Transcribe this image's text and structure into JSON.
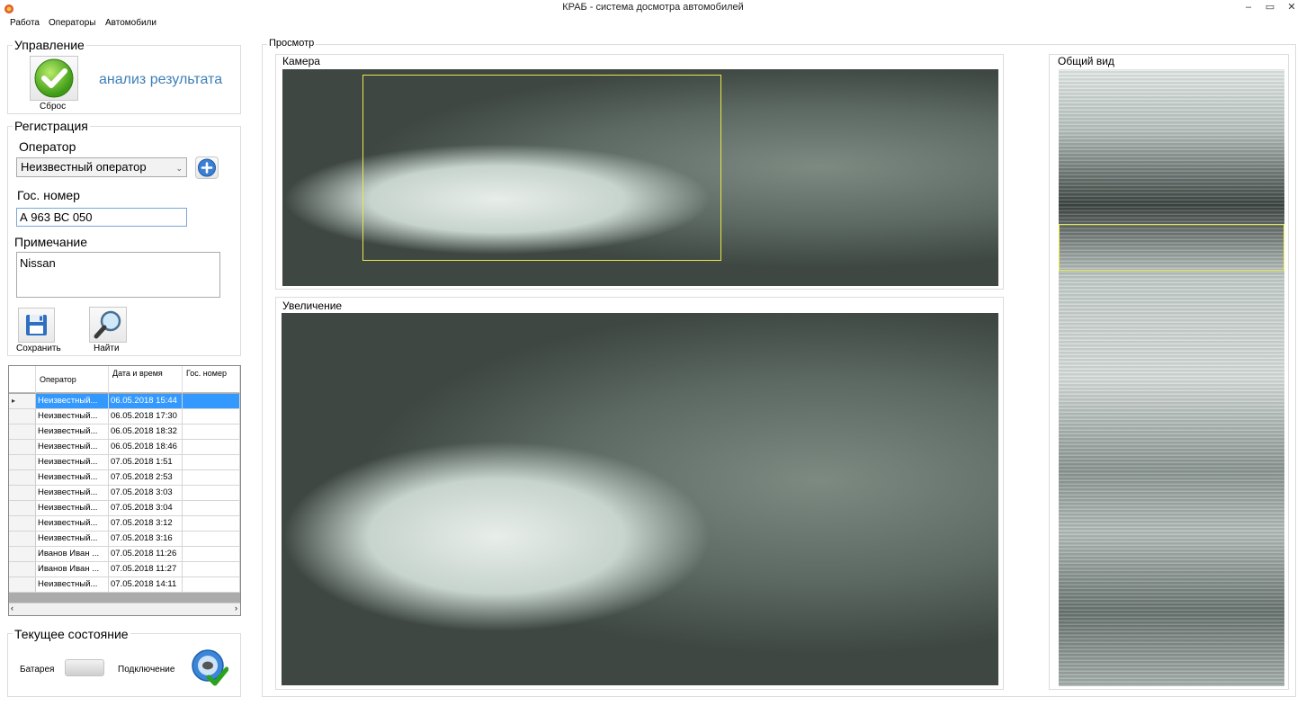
{
  "window": {
    "title": "КРАБ - система досмотра автомобилей",
    "controls": [
      "–",
      "▭",
      "✕"
    ]
  },
  "menu": [
    "Работа",
    "Операторы",
    "Автомобили"
  ],
  "control": {
    "title": "Управление",
    "reset_label": "Сброс",
    "status_text": "анализ результата"
  },
  "registration": {
    "title": "Регистрация",
    "operator_label": "Оператор",
    "operator_value": "Неизвестный оператор",
    "plate_label": "Гос. номер",
    "plate_value": "А 963 ВС 050",
    "note_label": "Примечание",
    "note_value": "Nissan",
    "save_label": "Сохранить",
    "find_label": "Найти"
  },
  "table": {
    "columns": [
      "Оператор",
      "Дата и время",
      "Гос. номер"
    ],
    "rows": [
      {
        "operator": "Неизвестный...",
        "datetime": "06.05.2018 15:44",
        "plate": "",
        "selected": true
      },
      {
        "operator": "Неизвестный...",
        "datetime": "06.05.2018 17:30",
        "plate": ""
      },
      {
        "operator": "Неизвестный...",
        "datetime": "06.05.2018 18:32",
        "plate": ""
      },
      {
        "operator": "Неизвестный...",
        "datetime": "06.05.2018 18:46",
        "plate": ""
      },
      {
        "operator": "Неизвестный...",
        "datetime": "07.05.2018 1:51",
        "plate": ""
      },
      {
        "operator": "Неизвестный...",
        "datetime": "07.05.2018 2:53",
        "plate": ""
      },
      {
        "operator": "Неизвестный...",
        "datetime": "07.05.2018 3:03",
        "plate": ""
      },
      {
        "operator": "Неизвестный...",
        "datetime": "07.05.2018 3:04",
        "plate": ""
      },
      {
        "operator": "Неизвестный...",
        "datetime": "07.05.2018 3:12",
        "plate": ""
      },
      {
        "operator": "Неизвестный...",
        "datetime": "07.05.2018 3:16",
        "plate": ""
      },
      {
        "operator": "Иванов Иван ...",
        "datetime": "07.05.2018 11:26",
        "plate": ""
      },
      {
        "operator": "Иванов Иван ...",
        "datetime": "07.05.2018 11:27",
        "plate": ""
      },
      {
        "operator": "Неизвестный...",
        "datetime": "07.05.2018 14:11",
        "plate": ""
      }
    ]
  },
  "state": {
    "title": "Текущее состояние",
    "battery_label": "Батарея",
    "connection_label": "Подключение"
  },
  "view": {
    "title": "Просмотр",
    "camera_label": "Камера",
    "zoom_label": "Увеличение",
    "overview_label": "Общий вид"
  },
  "colors": {
    "accent_text": "#3d7fb8",
    "selection": "#3399ff",
    "roi_frame": "#e8e84a"
  }
}
